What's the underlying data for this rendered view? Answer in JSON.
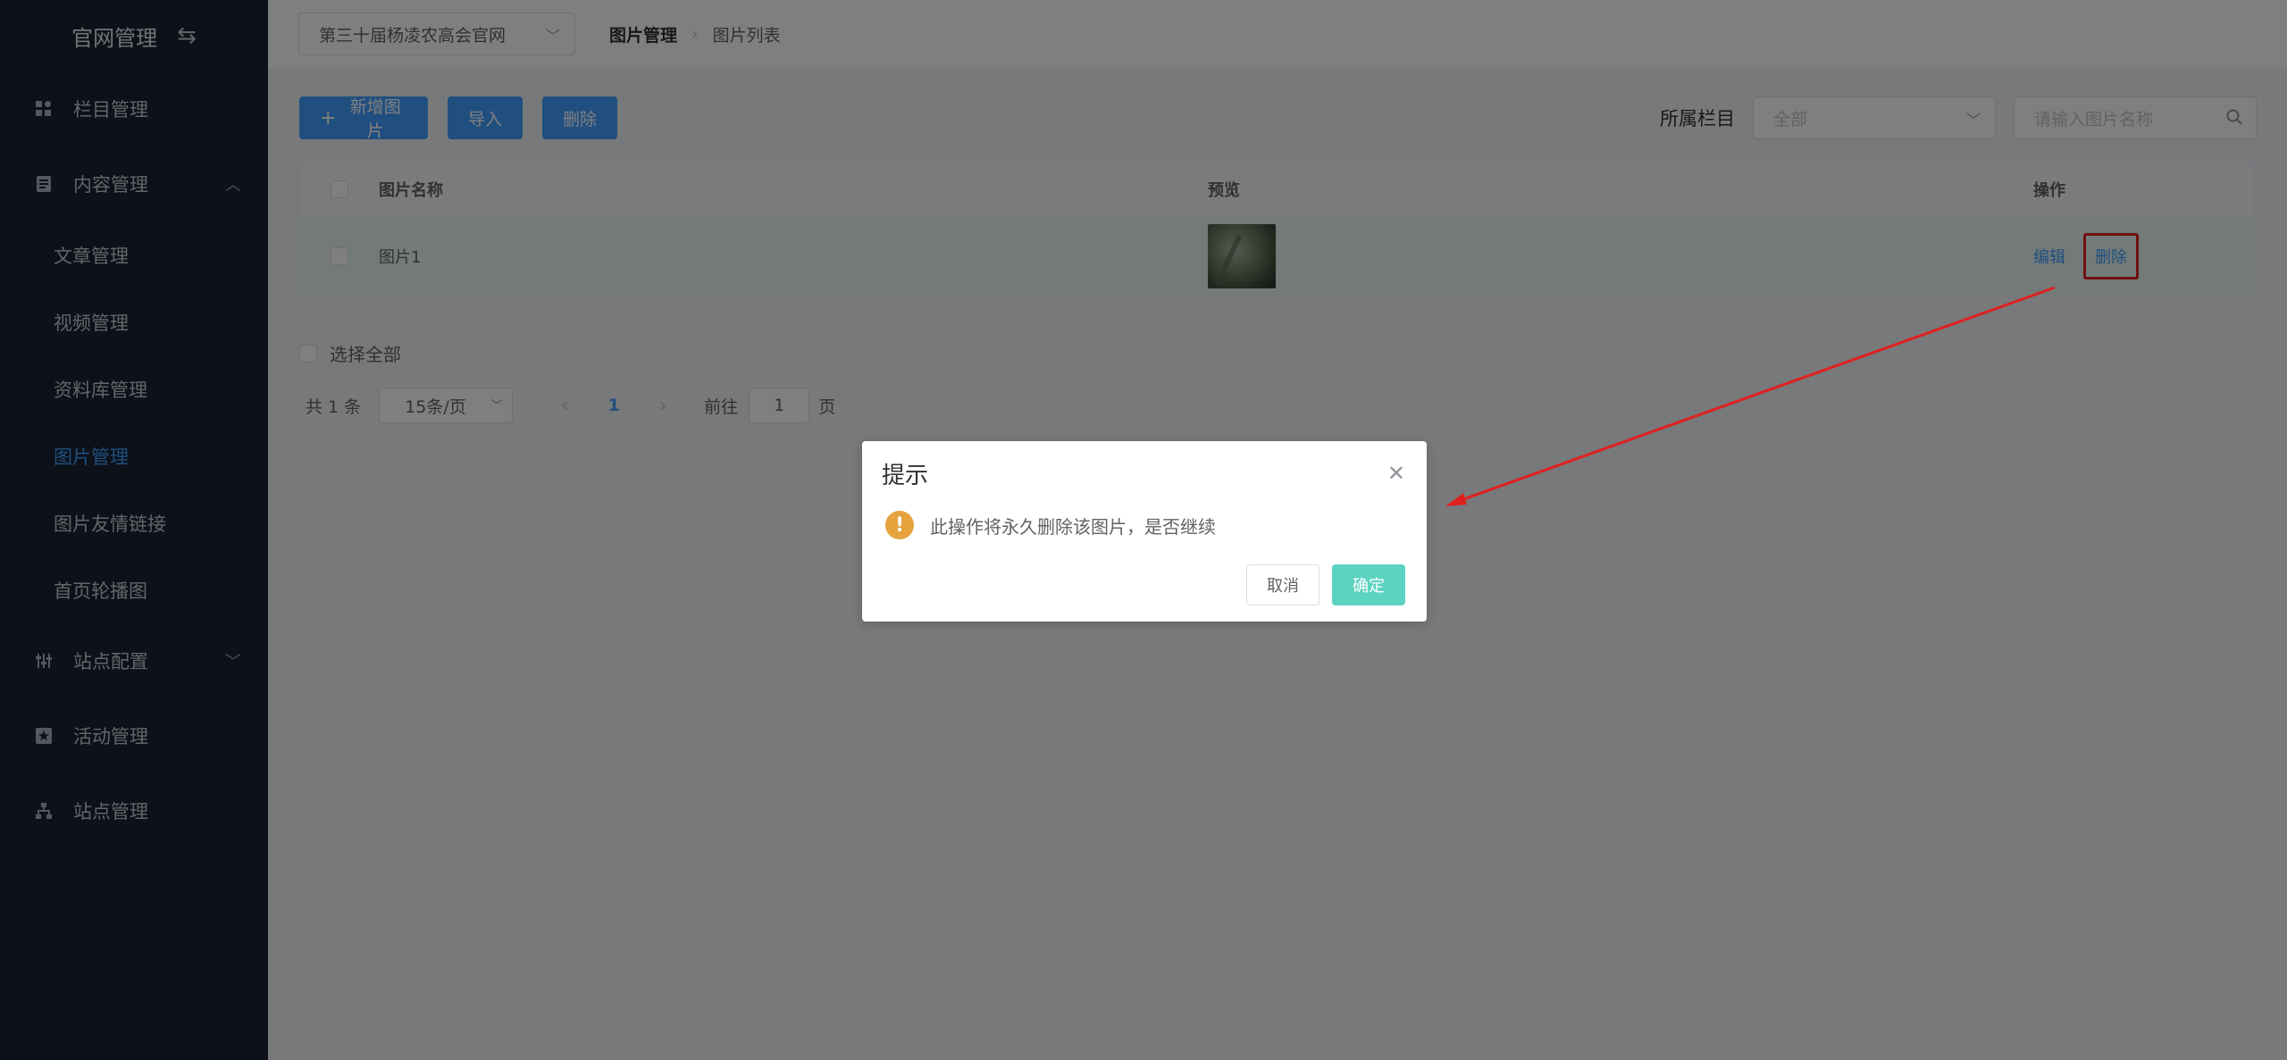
{
  "sidebar": {
    "brand": "官网管理",
    "menu": [
      {
        "label": "栏目管理"
      },
      {
        "label": "内容管理"
      }
    ],
    "sub_items": [
      {
        "label": "文章管理"
      },
      {
        "label": "视频管理"
      },
      {
        "label": "资料库管理"
      },
      {
        "label": "图片管理"
      },
      {
        "label": "图片友情链接"
      },
      {
        "label": "首页轮播图"
      }
    ],
    "menu_bottom": [
      {
        "label": "站点配置"
      },
      {
        "label": "活动管理"
      },
      {
        "label": "站点管理"
      }
    ],
    "active_color": "#409eff"
  },
  "topbar": {
    "site_select": "第三十届杨凌农高会官网",
    "breadcrumb": [
      "图片管理",
      "图片列表"
    ]
  },
  "toolbar": {
    "add_label": "新增图片",
    "import_label": "导入",
    "delete_label": "删除"
  },
  "filter": {
    "label": "所属栏目",
    "category_value": "全部",
    "search_placeholder": "请输入图片名称"
  },
  "table": {
    "headers": [
      "图片名称",
      "预览",
      "操作"
    ],
    "rows": [
      {
        "name": "图片1",
        "edit": "编辑",
        "delete": "删除"
      }
    ]
  },
  "select_all": "选择全部",
  "pagination": {
    "total": "共 1 条",
    "page_size": "15条/页",
    "current_page": "1",
    "goto_label": "前往",
    "goto_value": "1",
    "page_suffix": "页"
  },
  "dialog": {
    "title": "提示",
    "message": "此操作将永久删除该图片，是否继续",
    "cancel": "取消",
    "confirm": "确定"
  },
  "colors": {
    "primary": "#409eff",
    "sidebar_bg": "#1b2332",
    "confirm": "#5cd3c0",
    "warning": "#e6a23c",
    "annotation": "#e02020"
  }
}
